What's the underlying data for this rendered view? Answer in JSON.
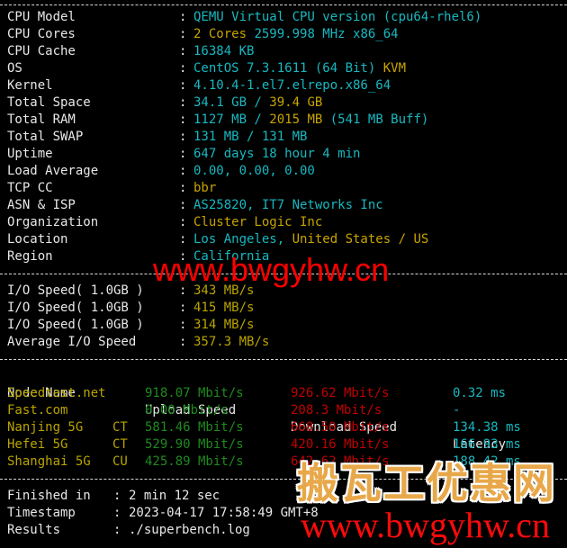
{
  "system_info": [
    {
      "label": "CPU Model",
      "parts": [
        {
          "text": "QEMU Virtual CPU version (cpu64-rhel6)",
          "color": "cyan"
        }
      ]
    },
    {
      "label": "CPU Cores",
      "parts": [
        {
          "text": "2 Cores ",
          "color": "yellow"
        },
        {
          "text": "2599.998 MHz x86_64",
          "color": "cyan"
        }
      ]
    },
    {
      "label": "CPU Cache",
      "parts": [
        {
          "text": "16384 KB",
          "color": "cyan"
        }
      ]
    },
    {
      "label": "OS",
      "parts": [
        {
          "text": "CentOS 7.3.1611 (64 Bit) ",
          "color": "cyan"
        },
        {
          "text": "KVM",
          "color": "yellow"
        }
      ]
    },
    {
      "label": "Kernel",
      "parts": [
        {
          "text": "4.10.4-1.el7.elrepo.x86_64",
          "color": "cyan"
        }
      ]
    },
    {
      "label": "Total Space",
      "parts": [
        {
          "text": "34.1 GB / ",
          "color": "cyan"
        },
        {
          "text": "39.4 GB",
          "color": "yellow"
        }
      ]
    },
    {
      "label": "Total RAM",
      "parts": [
        {
          "text": "1127 MB / ",
          "color": "cyan"
        },
        {
          "text": "2015 MB",
          "color": "yellow"
        },
        {
          "text": " (541 MB Buff)",
          "color": "cyan"
        }
      ]
    },
    {
      "label": "Total SWAP",
      "parts": [
        {
          "text": "131 MB / 131 MB",
          "color": "cyan"
        }
      ]
    },
    {
      "label": "Uptime",
      "parts": [
        {
          "text": "647 days 18 hour 4 min",
          "color": "cyan"
        }
      ]
    },
    {
      "label": "Load Average",
      "parts": [
        {
          "text": "0.00, 0.00, 0.00",
          "color": "cyan"
        }
      ]
    },
    {
      "label": "TCP CC",
      "parts": [
        {
          "text": "bbr",
          "color": "yellow"
        }
      ]
    },
    {
      "label": "ASN & ISP",
      "parts": [
        {
          "text": "AS25820, IT7 Networks Inc",
          "color": "cyan"
        }
      ]
    },
    {
      "label": "Organization",
      "parts": [
        {
          "text": "Cluster Logic Inc",
          "color": "yellow"
        }
      ]
    },
    {
      "label": "Location",
      "parts": [
        {
          "text": "Los Angeles, ",
          "color": "cyan"
        },
        {
          "text": "United States / US",
          "color": "yellow"
        }
      ]
    },
    {
      "label": "Region",
      "parts": [
        {
          "text": "California",
          "color": "cyan"
        }
      ]
    }
  ],
  "io_speed": [
    {
      "label": "I/O Speed( 1.0GB )",
      "value": "343 MB/s"
    },
    {
      "label": "I/O Speed( 1.0GB )",
      "value": "415 MB/s"
    },
    {
      "label": "I/O Speed( 1.0GB )",
      "value": "314 MB/s"
    },
    {
      "label": "Average I/O Speed",
      "value": "357.3 MB/s"
    }
  ],
  "speedtest": {
    "headers": [
      "Node Name",
      "Upload Speed",
      "Download Speed",
      "Latency"
    ],
    "rows": [
      {
        "node": "Speedtest.net",
        "isp": "",
        "upload": "918.07 Mbit/s",
        "download": "926.62 Mbit/s",
        "latency": "0.32 ms"
      },
      {
        "node": "Fast.com",
        "isp": "",
        "upload": "0.00 Mbit/s",
        "download": "208.3 Mbit/s",
        "latency": "-"
      },
      {
        "node": "Nanjing 5G",
        "isp": "CT",
        "upload": "581.46 Mbit/s",
        "download": "668.50 Mbit/s",
        "latency": "134.38 ms"
      },
      {
        "node": "Hefei 5G",
        "isp": "CT",
        "upload": "529.90 Mbit/s",
        "download": "420.16 Mbit/s",
        "latency": "166.93 ms"
      },
      {
        "node": "Shanghai 5G",
        "isp": "CU",
        "upload": "425.89 Mbit/s",
        "download": "642.62 Mbit/s",
        "latency": "188.42 ms"
      }
    ]
  },
  "summary": [
    {
      "label": "Finished in",
      "value": "2 min 12 sec"
    },
    {
      "label": "Timestamp",
      "value": "2023-04-17 17:58:49 GMT+8"
    },
    {
      "label": "Results",
      "value": "./superbench.log"
    }
  ],
  "separator": ":",
  "watermarks": {
    "top_url": "www.bwgyhw.cn",
    "brand_cn": "搬瓦工优惠网",
    "bottom_url": "www.bwgyhw.cn"
  },
  "colors": {
    "cyan": "#18b8c0",
    "yellow": "#c8a400",
    "green": "#1f8a1f",
    "red": "#c00000",
    "white": "#e8e8e8",
    "watermark_red": "#ff0000",
    "watermark_orange": "#e8a84a"
  }
}
